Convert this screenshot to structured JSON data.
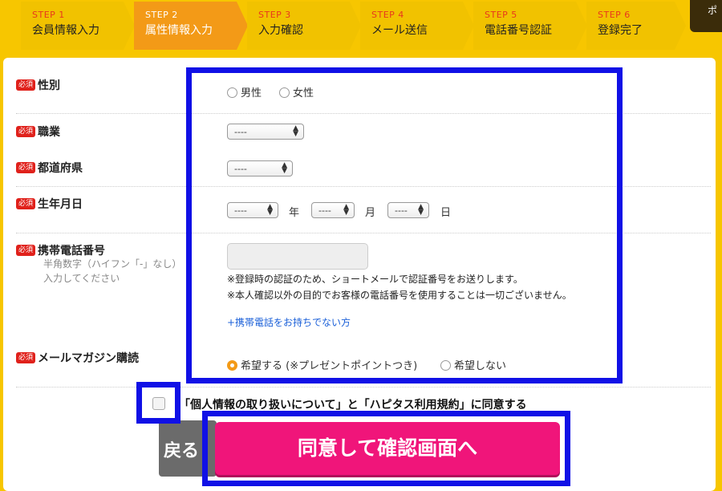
{
  "steps": [
    {
      "num": "STEP 1",
      "label": "会員情報入力"
    },
    {
      "num": "STEP 2",
      "label": "属性情報入力"
    },
    {
      "num": "STEP 3",
      "label": "入力確認"
    },
    {
      "num": "STEP 4",
      "label": "メール送信"
    },
    {
      "num": "STEP 5",
      "label": "電話番号認証"
    },
    {
      "num": "STEP 6",
      "label": "登録完了"
    }
  ],
  "edge_button": "ポ",
  "required_badge": "必須",
  "form": {
    "gender": {
      "label": "性別",
      "options": [
        "男性",
        "女性"
      ]
    },
    "occupation": {
      "label": "職業",
      "value": "----"
    },
    "prefecture": {
      "label": "都道府県",
      "value": "----"
    },
    "birthdate": {
      "label": "生年月日",
      "year": "----",
      "year_unit": "年",
      "month": "----",
      "month_unit": "月",
      "day": "----",
      "day_unit": "日"
    },
    "mobile": {
      "label": "携帯電話番号",
      "hint_line1": "半角数字（ハイフン「-」なし）",
      "hint_line2": "入力してください",
      "note1": "※登録時の認証のため、ショートメールで認証番号をお送りします。",
      "note2": "※本人確認以外の目的でお客様の電話番号を使用することは一切ございません。",
      "link": "+携帯電話をお持ちでない方"
    },
    "newsletter": {
      "label": "メールマガジン購読",
      "opt_yes": "希望する (※プレゼントポイントつき)",
      "opt_no": "希望しない"
    }
  },
  "agree_text": "「個人情報の取り扱いについて」と「ハピタス利用規約」に同意する",
  "back_button": "戻る",
  "submit_button": "同意して確認画面へ"
}
